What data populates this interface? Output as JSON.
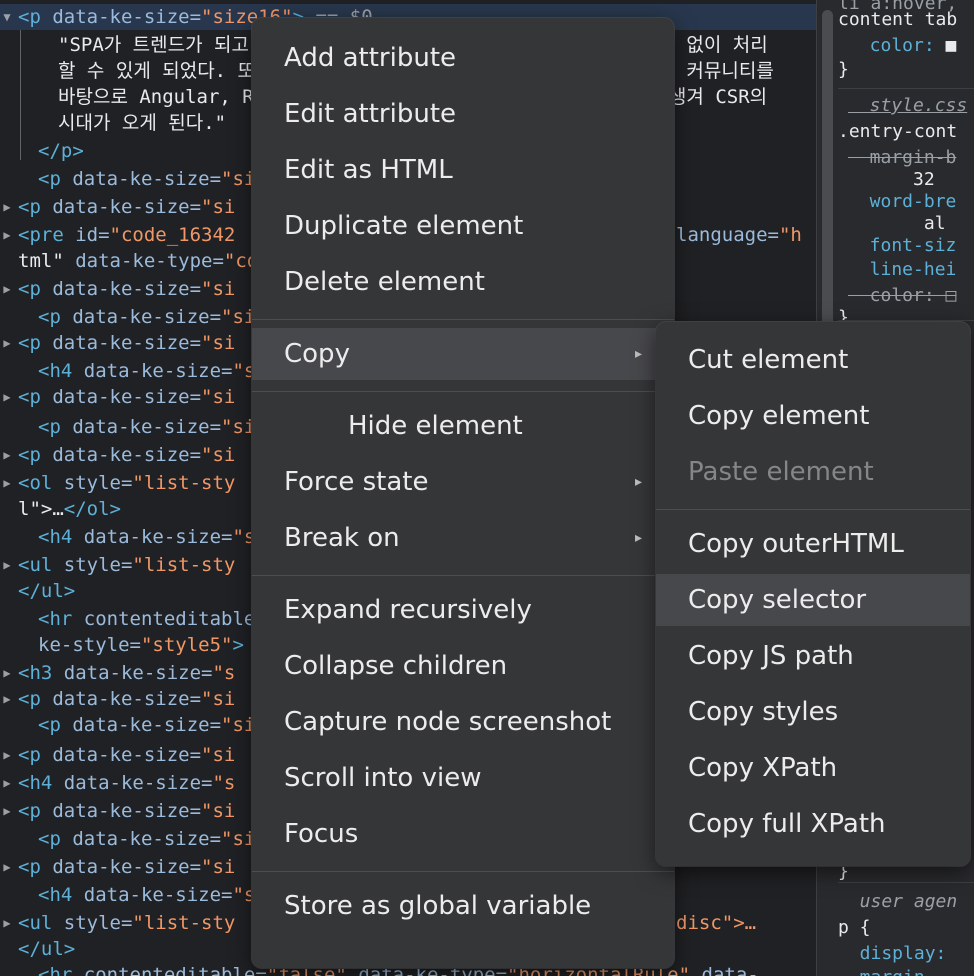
{
  "tree": {
    "lines": [
      {
        "arrow": "▼",
        "open": "<p ",
        "attr": "data-ke-size=",
        "val": "\"size16\"",
        "rest": "> ",
        "eq": "== $0",
        "selected": true
      },
      {
        "text": "\"SPA가 트렌드가 되고",
        "tail": "무리 없이 처리"
      },
      {
        "text": "할 수 있게 되었다. 또",
        "tail": "련한 커뮤니티를"
      },
      {
        "text": "바탕으로 Angular, R",
        "tail": "가 생겨 CSR의"
      },
      {
        "text": "시대가 오게 된다.\""
      },
      {
        "close": "</p>"
      },
      {
        "open": "<p ",
        "attr": "data-ke-size=",
        "val": "\"si"
      },
      {
        "arrow": "▶",
        "open": "<p ",
        "attr": "data-ke-size=",
        "val": "\"si"
      },
      {
        "arrow": "▶",
        "open": "<pre ",
        "attr": "id=",
        "val": "\"code_16342",
        "tailattr": "language=",
        "tailval": "\"h"
      },
      {
        "cont": "tml\" ",
        "attr": "data-ke-type=",
        "val": "\"co"
      },
      {
        "arrow": "▶",
        "open": "<p ",
        "attr": "data-ke-size=",
        "val": "\"si"
      },
      {
        "open": "<p ",
        "attr": "data-ke-size=",
        "val": "\"si"
      },
      {
        "arrow": "▶",
        "open": "<p ",
        "attr": "data-ke-size=",
        "val": "\"si"
      },
      {
        "open": "<h4 ",
        "attr": "data-ke-size=",
        "val": "\"s"
      },
      {
        "arrow": "▶",
        "open": "<p ",
        "attr": "data-ke-size=",
        "val": "\"si"
      },
      {
        "open": "<p ",
        "attr": "data-ke-size=",
        "val": "\"si"
      },
      {
        "arrow": "▶",
        "open": "<p ",
        "attr": "data-ke-size=",
        "val": "\"si"
      },
      {
        "arrow": "▶",
        "open": "<ol ",
        "attr": "style=",
        "val": "\"list-sty"
      },
      {
        "cont": "l\">",
        "txt": "…",
        "close": "</ol>"
      },
      {
        "open": "<h4 ",
        "attr": "data-ke-size=",
        "val": "\"s"
      },
      {
        "arrow": "▶",
        "open": "<ul ",
        "attr": "style=",
        "val": "\"list-sty"
      },
      {
        "close": "</ul>"
      },
      {
        "open": "<hr ",
        "attr": "contenteditable"
      },
      {
        "cont2": "ke-style=",
        "val": "\"style5\"",
        "rest": ">"
      },
      {
        "arrow": "▶",
        "open": "<h3 ",
        "attr": "data-ke-size=",
        "val": "\"s"
      },
      {
        "arrow": "▶",
        "open": "<p ",
        "attr": "data-ke-size=",
        "val": "\"si"
      },
      {
        "open": "<p ",
        "attr": "data-ke-size=",
        "val": "\"si"
      },
      {
        "arrow": "▶",
        "open": "<p ",
        "attr": "data-ke-size=",
        "val": "\"si"
      },
      {
        "arrow": "▶",
        "open": "<h4 ",
        "attr": "data-ke-size=",
        "val": "\"s"
      },
      {
        "arrow": "▶",
        "open": "<p ",
        "attr": "data-ke-size=",
        "val": "\"si"
      },
      {
        "open": "<p ",
        "attr": "data-ke-size=",
        "val": "\"si"
      },
      {
        "arrow": "▶",
        "open": "<p ",
        "attr": "data-ke-size=",
        "val": "\"si"
      },
      {
        "open": "<h4 ",
        "attr": "data-ke-size=",
        "val": "\"s"
      },
      {
        "arrow": "▶",
        "open": "<ul ",
        "attr": "style=",
        "val": "\"list-sty",
        "tailval": "disc\">…"
      },
      {
        "close": "</ul>"
      },
      {
        "open": "<hr ",
        "attr": "contenteditable=",
        "val": "\"false\"",
        "attr2": " data-ke-type=",
        "val2": "\"horizontalRule\"",
        "attr3": " data-"
      }
    ]
  },
  "styles": {
    "lines": [
      {
        "t": "li a:hover, ",
        "cls": "dim"
      },
      {
        "t": "content tab"
      },
      {
        "p": "  color: ",
        "v": "■"
      },
      {
        "t": "}"
      },
      {
        "link": "  style.css"
      },
      {
        "t": ".entry-cont"
      },
      {
        "p": "  margin-b",
        "strike": true
      },
      {
        "v": "      32"
      },
      {
        "p": "  word-bre"
      },
      {
        "v": "       al"
      },
      {
        "p": "  font-siz"
      },
      {
        "p": "  line-hei"
      },
      {
        "p": "  color: ",
        "v": "□",
        "strike": true
      },
      {
        "t": "}"
      }
    ],
    "bottom": [
      {
        "t": "}"
      },
      {
        "ua": "  user agen"
      },
      {
        "t": "p {"
      },
      {
        "p": "  display:"
      },
      {
        "p": "  margin-"
      }
    ]
  },
  "menu": {
    "items": [
      {
        "label": "Add attribute"
      },
      {
        "label": "Edit attribute"
      },
      {
        "label": "Edit as HTML"
      },
      {
        "label": "Duplicate element"
      },
      {
        "label": "Delete element"
      },
      {
        "sep": true
      },
      {
        "label": "Copy",
        "submenu": true,
        "highlighted": true
      },
      {
        "sep": true
      },
      {
        "label": "Hide element",
        "indent": true
      },
      {
        "label": "Force state",
        "submenu": true
      },
      {
        "label": "Break on",
        "submenu": true
      },
      {
        "sep": true
      },
      {
        "label": "Expand recursively"
      },
      {
        "label": "Collapse children"
      },
      {
        "label": "Capture node screenshot"
      },
      {
        "label": "Scroll into view"
      },
      {
        "label": "Focus"
      },
      {
        "sep": true
      },
      {
        "label": "Store as global variable"
      }
    ]
  },
  "submenu": {
    "items": [
      {
        "label": "Cut element"
      },
      {
        "label": "Copy element"
      },
      {
        "label": "Paste element",
        "disabled": true
      },
      {
        "sep": true
      },
      {
        "label": "Copy outerHTML"
      },
      {
        "label": "Copy selector",
        "highlighted": true
      },
      {
        "label": "Copy JS path"
      },
      {
        "label": "Copy styles"
      },
      {
        "label": "Copy XPath"
      },
      {
        "label": "Copy full XPath"
      }
    ]
  },
  "icons": {
    "submenu_arrow": "▸"
  }
}
